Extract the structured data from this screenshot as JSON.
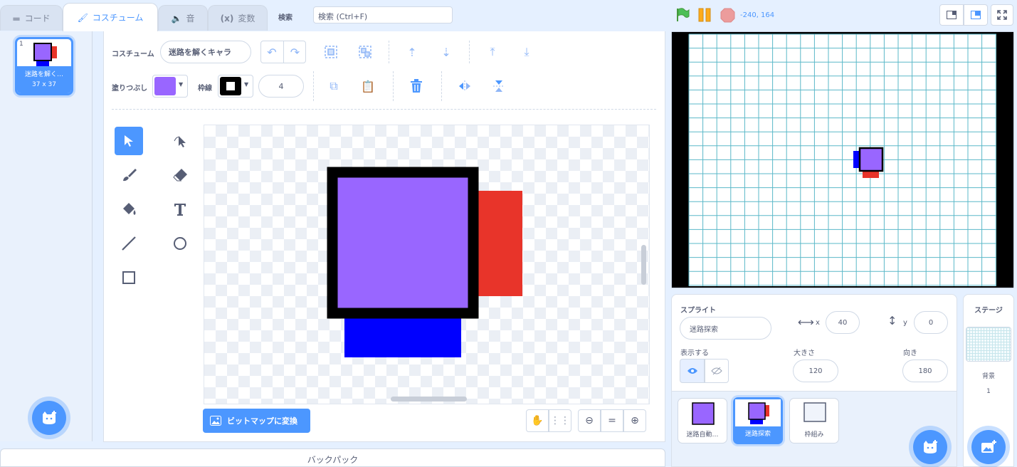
{
  "tabs": {
    "code": "コード",
    "costumes": "コスチューム",
    "sounds": "音",
    "variables": "変数"
  },
  "search": {
    "label": "検索",
    "placeholder": "検索 (Ctrl+F)"
  },
  "stage_header": {
    "coords": "-240, 164"
  },
  "costume_list": [
    {
      "index": "1",
      "name": "迷路を解く…",
      "size": "37 x 37"
    }
  ],
  "editor": {
    "costume_label": "コスチューム",
    "costume_name": "迷路を解くキャラ",
    "fill_label": "塗りつぶし",
    "fill_color": "#9966ff",
    "outline_label": "枠線",
    "outline_color": "#000000",
    "outline_width": "4",
    "convert_button": "ビットマップに変換"
  },
  "sprite_info": {
    "title": "スプライト",
    "name": "迷路探索",
    "x_label": "x",
    "x": "40",
    "y_label": "y",
    "y": "0",
    "show_label": "表示する",
    "size_label": "大きさ",
    "size": "120",
    "direction_label": "向き",
    "direction": "180"
  },
  "sprites": [
    {
      "name": "迷路自動…"
    },
    {
      "name": "迷路探索"
    },
    {
      "name": "枠組み"
    }
  ],
  "stage_panel": {
    "title": "ステージ",
    "backdrop_label": "背景",
    "backdrop_count": "1"
  },
  "backpack": {
    "label": "バックパック"
  },
  "colors": {
    "accent": "#4c97ff",
    "costume_purple": "#9966ff",
    "red": "#e8342a",
    "blue": "#0000ff",
    "grid": "#5bb8c8"
  }
}
